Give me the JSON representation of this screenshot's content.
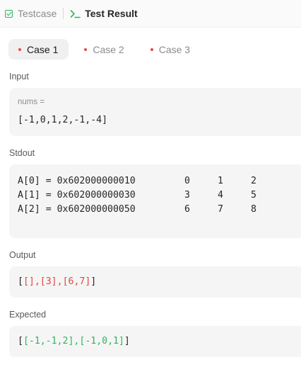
{
  "tabs": {
    "testcase": "Testcase",
    "result": "Test Result"
  },
  "cases": [
    "Case 1",
    "Case 2",
    "Case 3"
  ],
  "input": {
    "label": "Input",
    "param_name": "nums =",
    "param_value": "[-1,0,1,2,-1,-4]"
  },
  "stdout": {
    "label": "Stdout",
    "lines": [
      {
        "addr": "A[0] = 0x602000000010",
        "nums": [
          "0",
          "1",
          "2"
        ]
      },
      {
        "addr": "A[1] = 0x602000000030",
        "nums": [
          "3",
          "4",
          "5"
        ]
      },
      {
        "addr": "A[2] = 0x602000000050",
        "nums": [
          "6",
          "7",
          "8"
        ]
      }
    ]
  },
  "output": {
    "label": "Output",
    "open": "[",
    "parts": [
      "[]",
      ",",
      "[3]",
      ",",
      "[6,7]"
    ],
    "close": "]"
  },
  "expected": {
    "label": "Expected",
    "open": "[",
    "parts": [
      "[-1,-1,2]",
      ",",
      "[-1,0,1]"
    ],
    "close": "]"
  },
  "colors": {
    "accent_green": "#2db55d",
    "diff_red": "#e5453f",
    "case_dot": "#ef4743"
  },
  "icons": {
    "testcase_icon": "checkbox-icon",
    "result_icon": "terminal-icon"
  }
}
